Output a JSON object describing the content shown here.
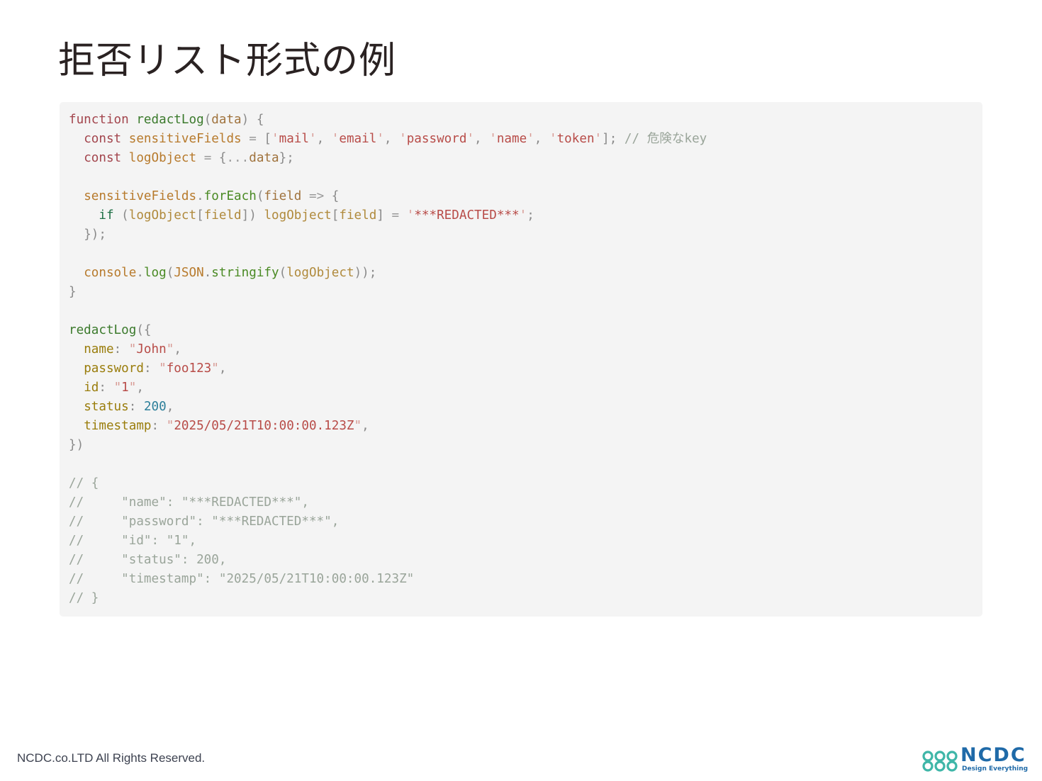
{
  "slide": {
    "title": "拒否リスト形式の例"
  },
  "code": {
    "lines": [
      "function redactLog(data) {",
      "  const sensitiveFields = ['mail', 'email', 'password', 'name', 'token']; // 危険なkey",
      "  const logObject = {...data};",
      "",
      "  sensitiveFields.forEach(field => {",
      "    if (logObject[field]) logObject[field] = '***REDACTED***';",
      "  });",
      "",
      "  console.log(JSON.stringify(logObject));",
      "}",
      "",
      "redactLog({",
      "  name: \"John\",",
      "  password: \"foo123\",",
      "  id: \"1\",",
      "  status: 200,",
      "  timestamp: \"2025/05/21T10:00:00.123Z\",",
      "})",
      "",
      "// {",
      "//     \"name\": \"***REDACTED***\",",
      "//     \"password\": \"***REDACTED***\",",
      "//     \"id\": \"1\",",
      "//     \"status\": 200,",
      "//     \"timestamp\": \"2025/05/21T10:00:00.123Z\"",
      "// }"
    ]
  },
  "footer": {
    "copyright": "NCDC.co.LTD All Rights Reserved."
  },
  "logo": {
    "name": "NCDC",
    "tagline": "Design Everything",
    "icon": "interlocking-loops-icon",
    "colors": {
      "primary": "#1f6aa8",
      "accent": "#3fb6a8"
    }
  }
}
